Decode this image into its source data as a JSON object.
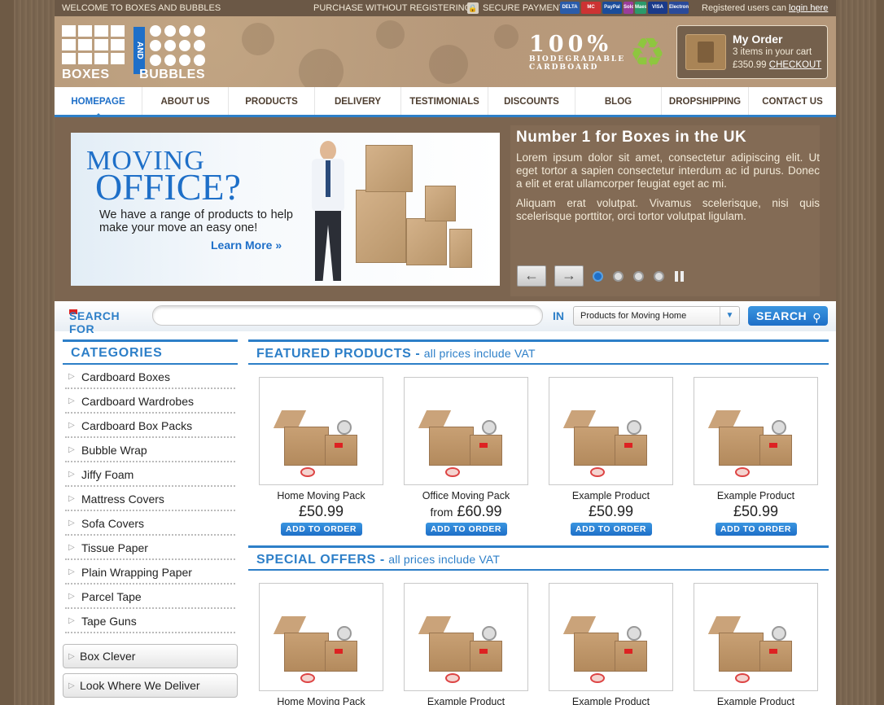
{
  "topbar": {
    "welcome": "WELCOME TO BOXES AND BUBBLES",
    "purchase": "PURCHASE WITHOUT REGISTERING!",
    "secure": "SECURE PAYMENT",
    "cards": [
      "DELTA",
      "MC",
      "PayPal",
      "Solo",
      "Maestro",
      "VISA",
      "Electron"
    ],
    "registered": "Registered users can",
    "login": "login here"
  },
  "logo": {
    "left_word": "BOXES",
    "mid_word": "AND",
    "right_word": "BUBBLES"
  },
  "bio": {
    "pct": "100%",
    "line1": "BIODEGRADABLE",
    "line2": "CARDBOARD"
  },
  "order": {
    "title": "My Order",
    "items": "3 items in your cart",
    "total": "£350.99",
    "checkout": "CHECKOUT"
  },
  "nav": [
    "HOMEPAGE",
    "ABOUT US",
    "PRODUCTS",
    "DELIVERY",
    "TESTIMONIALS",
    "DISCOUNTS",
    "BLOG",
    "DROPSHIPPING",
    "CONTACT US"
  ],
  "promo": {
    "moving": "MOVING",
    "office": "OFFICE?",
    "desc": "We have a range of products to help make your move an easy one!",
    "learn": "Learn More »"
  },
  "slide": {
    "title": "Number 1 for Boxes in the UK",
    "p1": "Lorem ipsum dolor sit amet, consectetur adipiscing elit. Ut eget tortor a sapien consectetur interdum ac id purus. Donec a elit et erat ullamcorper feugiat eget ac mi.",
    "p2": "Aliquam erat volutpat. Vivamus scelerisque, nisi quis scelerisque porttitor, orci tortor volutpat ligulam."
  },
  "search": {
    "label": "SEARCH FOR",
    "placeholder": "",
    "in": "IN",
    "selected": "Products for Moving Home",
    "button": "SEARCH"
  },
  "categories": {
    "title": "CATEGORIES",
    "items": [
      "Cardboard Boxes",
      "Cardboard Wardrobes",
      "Cardboard Box Packs",
      "Bubble Wrap",
      "Jiffy Foam",
      "Mattress Covers",
      "Sofa Covers",
      "Tissue Paper",
      "Plain Wrapping Paper",
      "Parcel Tape",
      "Tape Guns"
    ],
    "box_clever": "Box Clever",
    "deliver": "Look Where We Deliver"
  },
  "featured": {
    "title": "FEATURED PRODUCTS -",
    "sub": "all prices include VAT",
    "products": [
      {
        "name": "Home Moving Pack",
        "from": "",
        "price": "£50.99",
        "button": "ADD TO ORDER"
      },
      {
        "name": "Office Moving Pack",
        "from": "from",
        "price": "£60.99",
        "button": "ADD TO ORDER"
      },
      {
        "name": "Example Product",
        "from": "",
        "price": "£50.99",
        "button": "ADD TO ORDER"
      },
      {
        "name": "Example Product",
        "from": "",
        "price": "£50.99",
        "button": "ADD TO ORDER"
      }
    ]
  },
  "special": {
    "title": "SPECIAL OFFERS -",
    "sub": "all prices include VAT",
    "products": [
      {
        "name": "Home Moving Pack"
      },
      {
        "name": "Example Product"
      },
      {
        "name": "Example Product"
      },
      {
        "name": "Example Product"
      }
    ]
  },
  "colors": {
    "accent": "#2d7fc8",
    "brown": "#6b5846"
  }
}
